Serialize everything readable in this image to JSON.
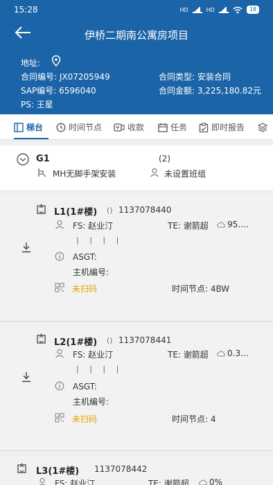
{
  "status": {
    "time": "15:28",
    "net1": "HD",
    "net2": "HD",
    "battery": "18"
  },
  "header": {
    "title": "伊桥二期南公寓房项目",
    "address_label": "地址:",
    "contract_no": "合同编号: JX07205949",
    "contract_type": "合同类型: 安装合同",
    "sap_no": "SAP编号: 6596040",
    "contract_amount": "合同金额: 3,225,180.82元",
    "ps": "PS: 王星"
  },
  "tabs": [
    {
      "label": "梯台",
      "icon": "elevator-icon"
    },
    {
      "label": "时间节点",
      "icon": "clock-icon"
    },
    {
      "label": "收款",
      "icon": "payment-icon"
    },
    {
      "label": "任务",
      "icon": "calendar-icon"
    },
    {
      "label": "即时报告",
      "icon": "clipboard-icon"
    }
  ],
  "group": {
    "name": "G1",
    "count": "(2)",
    "scaffold": "MH无脚手架安装",
    "team": "未设置班组"
  },
  "units": [
    {
      "name": "L1(1#楼)",
      "paren": "()",
      "code": "1137078440",
      "fs": "FS: 赵业汀",
      "te": "TE: 谢箭超",
      "progress": "95....",
      "bars": "| | | |",
      "asgt": "ASGT:",
      "host": "主机编号:",
      "scan": "未扫码",
      "node": "时间节点: 4BW"
    },
    {
      "name": "L2(1#楼)",
      "paren": "()",
      "code": "1137078441",
      "fs": "FS: 赵业汀",
      "te": "TE: 谢箭超",
      "progress": "0.3...",
      "bars": "| | | |",
      "asgt": "ASGT:",
      "host": "主机编号:",
      "scan": "未扫码",
      "node": "时间节点: 4"
    },
    {
      "name": "L3(1#楼)",
      "code": "1137078442",
      "fs": "FS: 赵业汀",
      "te": "TE: 谢箭超",
      "progress": "0%"
    }
  ],
  "colors": {
    "primary": "#1b64a8",
    "warning": "#e8a000"
  }
}
